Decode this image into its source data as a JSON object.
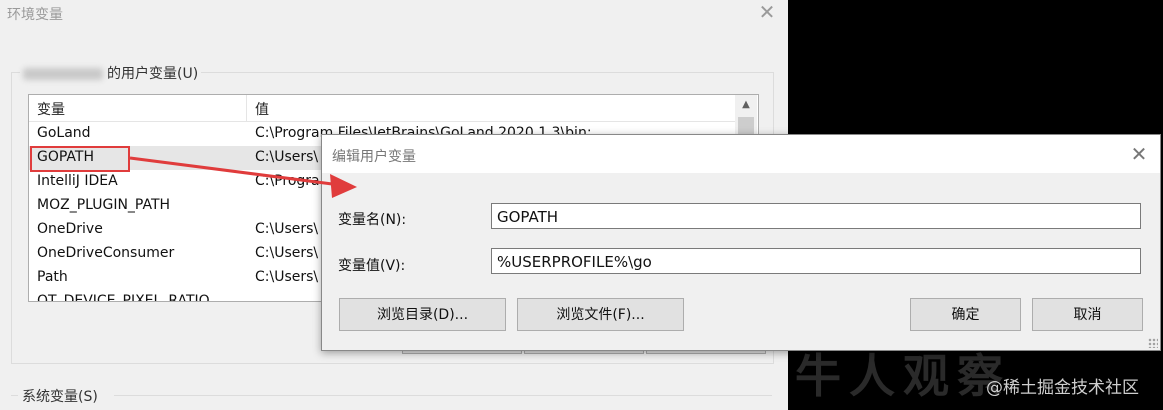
{
  "background_window": {
    "title": "环境变量",
    "user_group_label": "的用户变量(U)",
    "columns": [
      "变量",
      "值"
    ],
    "rows": [
      {
        "name": "GoLand",
        "value": "C:\\Program Files\\JetBrains\\GoLand 2020.1.3\\bin;"
      },
      {
        "name": "GOPATH",
        "value": "C:\\Users\\"
      },
      {
        "name": "IntelliJ IDEA",
        "value": "C:\\Progra"
      },
      {
        "name": "MOZ_PLUGIN_PATH",
        "value": ""
      },
      {
        "name": "OneDrive",
        "value": "C:\\Users\\"
      },
      {
        "name": "OneDriveConsumer",
        "value": "C:\\Users\\"
      },
      {
        "name": "Path",
        "value": "C:\\Users\\"
      },
      {
        "name": "QT_DEVICE_PIXEL_RATIO",
        "value": ""
      }
    ],
    "system_group_label": "系统变量(S)"
  },
  "dialog": {
    "title": "编辑用户变量",
    "name_label": "变量名(N):",
    "name_value": "GOPATH",
    "value_label": "变量值(V):",
    "value_value": "%USERPROFILE%\\go",
    "browse_dir_button": "浏览目录(D)...",
    "browse_file_button": "浏览文件(F)...",
    "ok_button": "确定",
    "cancel_button": "取消"
  },
  "watermark": "@稀土掘金技术社区",
  "colors": {
    "highlight": "#e03c3c",
    "arrow": "#e03c3c"
  }
}
